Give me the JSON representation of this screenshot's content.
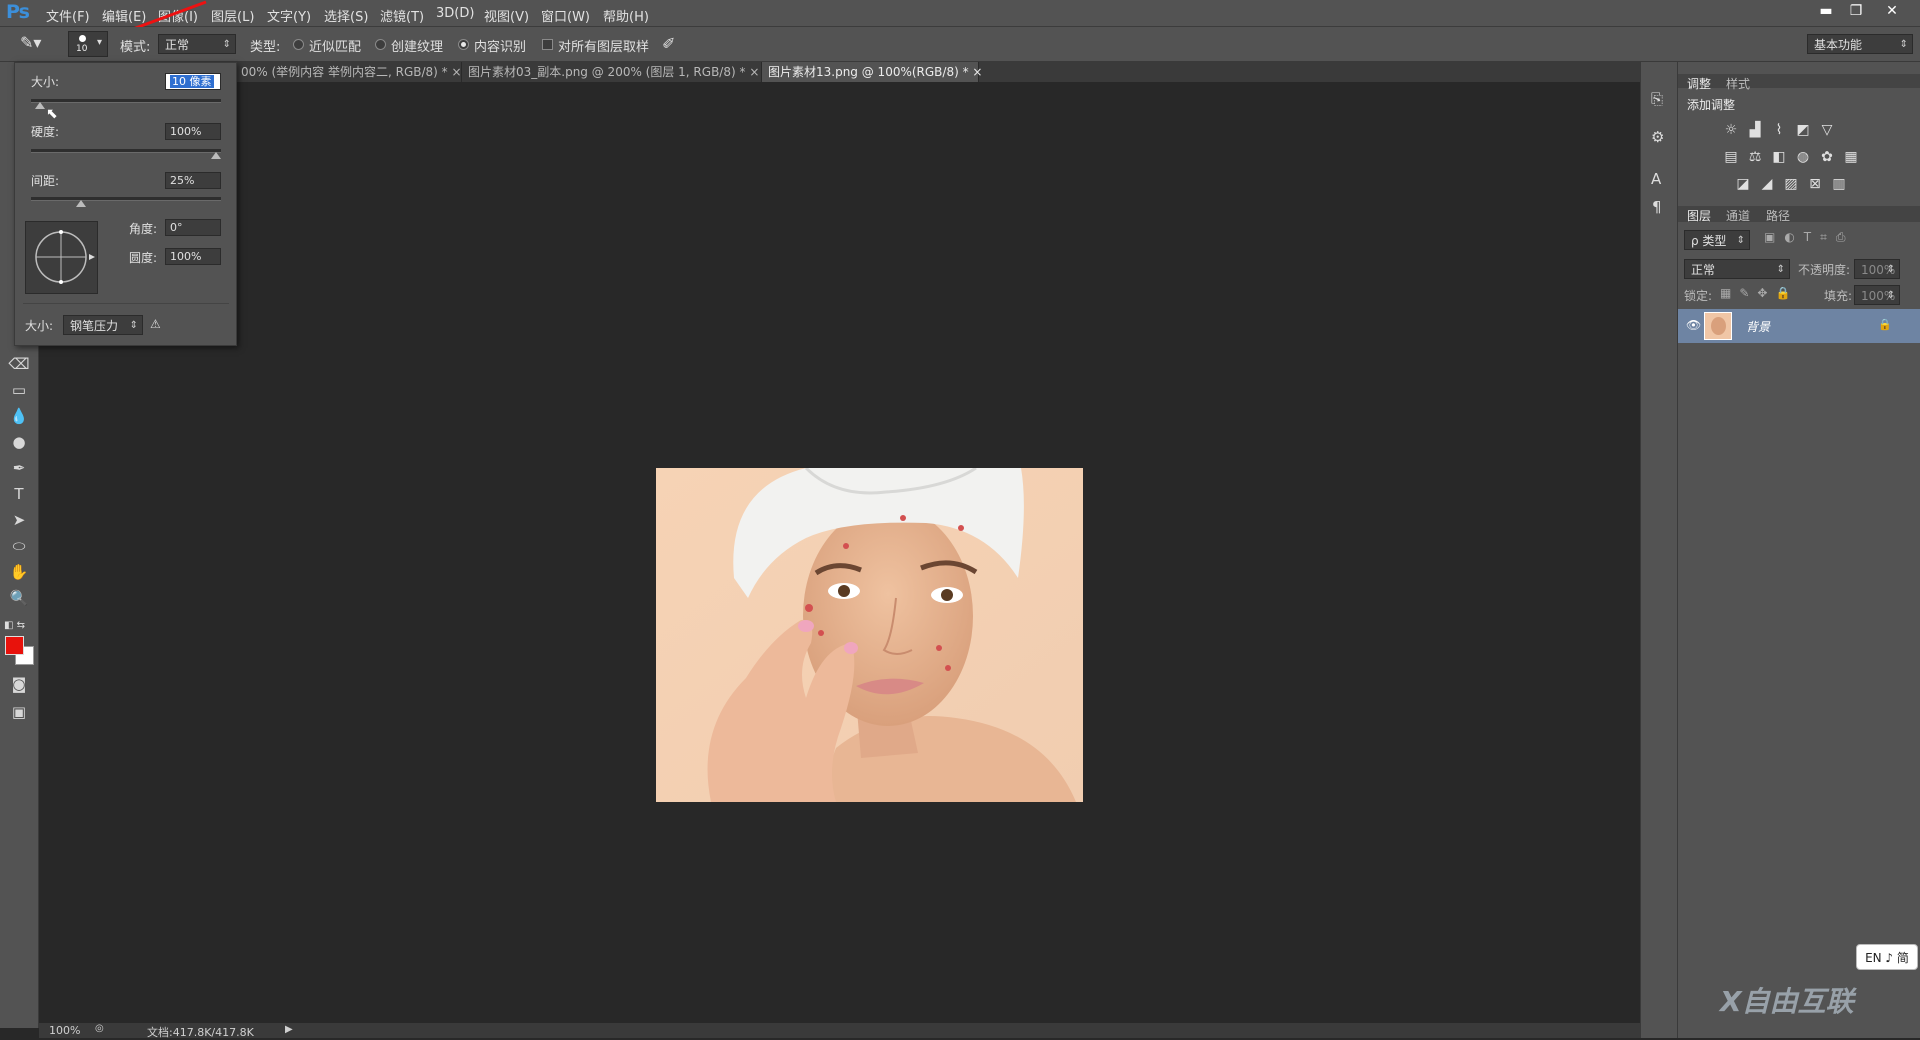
{
  "app": {
    "logo": "Ps"
  },
  "menu": [
    "文件(F)",
    "编辑(E)",
    "图像(I)",
    "图层(L)",
    "文字(Y)",
    "选择(S)",
    "滤镜(T)",
    "3D(D)",
    "视图(V)",
    "窗口(W)",
    "帮助(H)"
  ],
  "window_controls": {
    "minimize": "▬",
    "restore": "❐",
    "close": "✕"
  },
  "options": {
    "brush_size_badge": "10",
    "mode_label": "模式:",
    "mode_value": "正常",
    "type_label": "类型:",
    "radio_proximity": "近似匹配",
    "radio_texture": "创建纹理",
    "radio_content_aware": "内容识别",
    "checkbox_sample_all": "对所有图层取样",
    "workspace": "基本功能"
  },
  "tabs": [
    "00% (举例内容 举例内容二, RGB/8) *",
    "图片素材03_副本.png @ 200% (图层 1, RGB/8) *",
    "图片素材13.png @ 100%(RGB/8) *"
  ],
  "tab_close": "×",
  "brush_panel": {
    "size_label": "大小:",
    "size_value": "10 像素",
    "hardness_label": "硬度:",
    "hardness_value": "100%",
    "spacing_label": "间距:",
    "spacing_value": "25%",
    "angle_label": "角度:",
    "angle_value": "0°",
    "roundness_label": "圆度:",
    "roundness_value": "100%",
    "pressure_label": "大小:",
    "pressure_value": "钢笔压力",
    "size_level": 0.02,
    "hardness_level": 1.0,
    "spacing_level": 0.25
  },
  "status": {
    "zoom": "100%",
    "doc": "文档:417.8K/417.8K"
  },
  "right_panel": {
    "tab_adjust": "调整",
    "tab_styles": "样式",
    "add_adjustment": "添加调整",
    "tab_layers": "图层",
    "tab_channels": "通道",
    "tab_paths": "路径",
    "filter_kind": "ρ 类型",
    "blend_mode": "正常",
    "opacity_label": "不透明度:",
    "opacity_value": "100%",
    "lock_label": "锁定:",
    "fill_label": "填充:",
    "fill_value": "100%",
    "layer_name": "背景"
  },
  "ime": "EN ♪ 简",
  "watermark": "X自由互联",
  "colors": {
    "foreground": "#e8120c",
    "background": "#ffffff",
    "selected_layer": "#6e84a3",
    "accent": "#3c8fda"
  }
}
